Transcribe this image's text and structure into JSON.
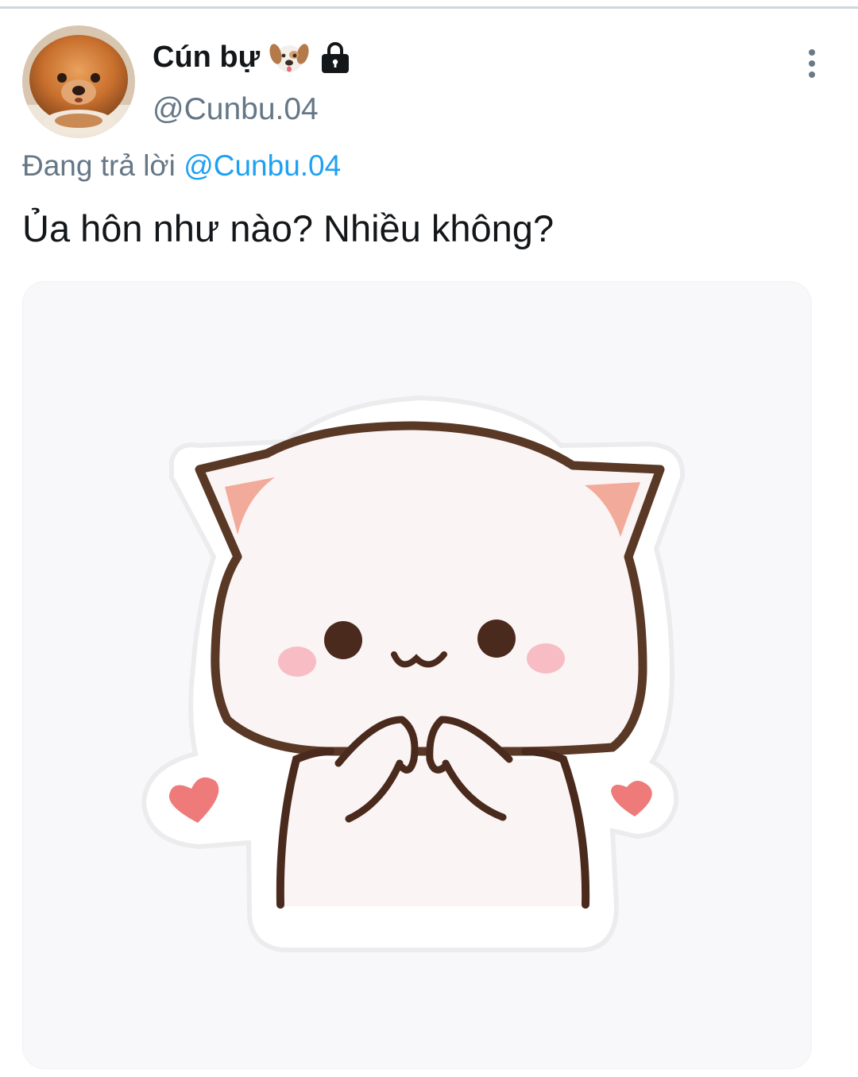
{
  "tweet": {
    "display_name": "Cún bự",
    "name_emoji": "dog-face-emoji",
    "name_badge": "lock-icon",
    "handle": "@Cunbu.04",
    "reply_prefix": "Đang trả lời",
    "reply_mention": "@Cunbu.04",
    "text": "Ủa hôn như nào? Nhiều không?",
    "media": {
      "description_icon": "cat-sticker-image"
    }
  },
  "colors": {
    "text_primary": "#14171a",
    "text_secondary": "#657786",
    "link": "#1da1f2",
    "media_background": "#f8f8fa"
  }
}
